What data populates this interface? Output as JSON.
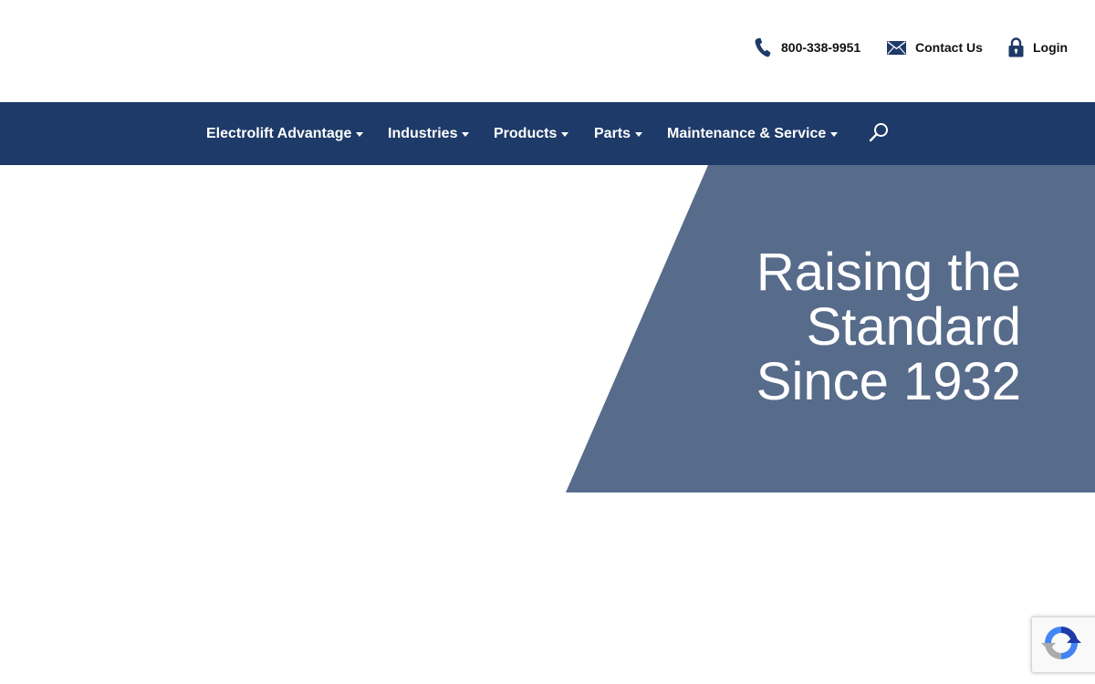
{
  "header": {
    "phone": {
      "label": "800-338-9951",
      "icon": "phone-icon"
    },
    "contact": {
      "label": "Contact Us",
      "icon": "envelope-icon"
    },
    "login": {
      "label": "Login",
      "icon": "lock-icon"
    }
  },
  "nav": {
    "items": [
      {
        "label": "Electrolift Advantage"
      },
      {
        "label": "Industries"
      },
      {
        "label": "Products"
      },
      {
        "label": "Parts"
      },
      {
        "label": "Maintenance & Service"
      }
    ],
    "search_icon": "search-icon"
  },
  "hero": {
    "title_lines": [
      "Raising the",
      "Standard",
      "Since 1932"
    ]
  },
  "colors": {
    "nav_background": "#1e3a68",
    "hero_panel": "#576b8b",
    "icon_blue": "#1e3a68",
    "text_dark": "#111111"
  }
}
